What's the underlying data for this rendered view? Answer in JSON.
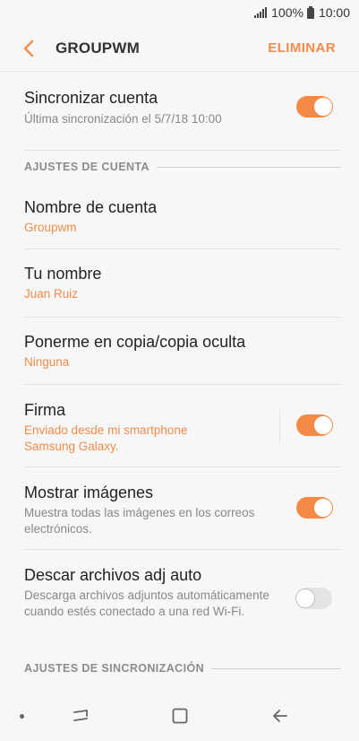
{
  "status": {
    "battery": "100%",
    "time": "10:00"
  },
  "header": {
    "title": "GROUPWM",
    "delete_label": "ELIMINAR"
  },
  "sync": {
    "label": "Sincronizar cuenta",
    "sub": "Última sincronización el 5/7/18  10:00",
    "toggle": true
  },
  "sections": {
    "account": "AJUSTES DE CUENTA",
    "sync": "AJUSTES DE SINCRONIZACIÓN"
  },
  "account_name": {
    "label": "Nombre de cuenta",
    "value": "Groupwm"
  },
  "your_name": {
    "label": "Tu nombre",
    "value": "Juan Ruiz"
  },
  "cc_bcc": {
    "label": "Ponerme en copia/copia oculta",
    "value": "Ninguna"
  },
  "signature": {
    "label": "Firma",
    "value": "Enviado desde mi smartphone Samsung Galaxy.",
    "toggle": true
  },
  "show_images": {
    "label": "Mostrar imágenes",
    "sub": "Muestra todas las imágenes en los correos electrónicos.",
    "toggle": true
  },
  "auto_download": {
    "label": "Descar archivos adj auto",
    "sub": "Descarga archivos adjuntos automáticamente cuando estés conectado a una red Wi-Fi.",
    "toggle": false
  },
  "colors": {
    "accent": "#f08c4c",
    "toggle_on": "#f48a45"
  },
  "icons": {
    "back": "chevron-left-icon",
    "signal": "signal-icon",
    "battery": "battery-icon",
    "nav_recents": "recents-icon",
    "nav_home": "home-icon",
    "nav_back": "back-arrow-icon"
  }
}
